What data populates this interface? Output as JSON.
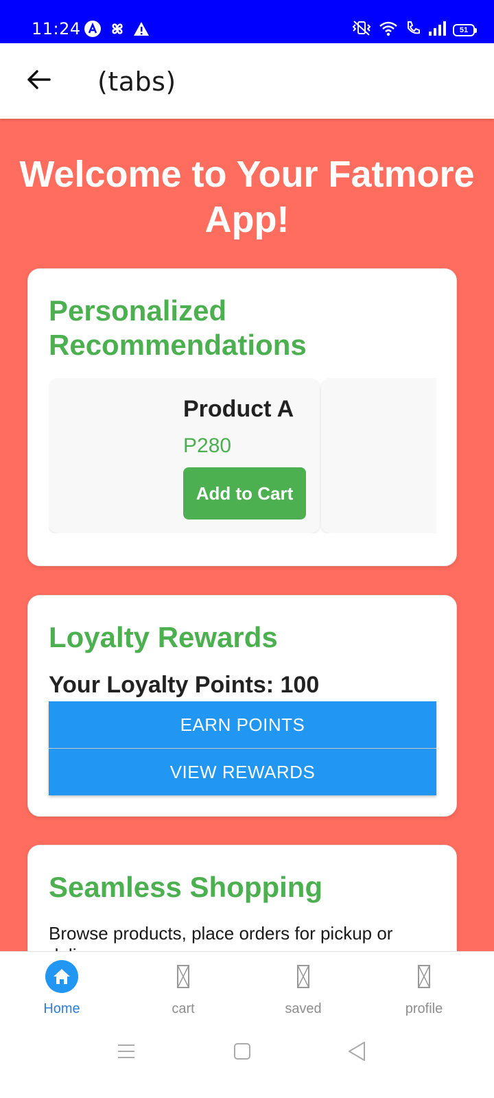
{
  "status_bar": {
    "time": "11:24",
    "battery": "51",
    "left_icons": [
      "a-circle-icon",
      "fan-icon",
      "warning-icon"
    ],
    "right_icons": [
      "vibrate-icon",
      "wifi-icon",
      "call-icon",
      "signal-icon",
      "battery-icon"
    ],
    "background": "#0000ff"
  },
  "header": {
    "back_icon": "arrow-left-icon",
    "title": "(tabs)"
  },
  "main": {
    "background": "#ff6d5e",
    "welcome_title": "Welcome to Your Fatmore App!",
    "recommendations": {
      "title": "Personalized Recommendations",
      "products": [
        {
          "name": "Product A",
          "price": "P280",
          "button_label": "Add to Cart"
        }
      ]
    },
    "loyalty": {
      "title": "Loyalty Rewards",
      "points_text": "Your Loyalty Points: 100",
      "earn_button": "EARN POINTS",
      "view_button": "VIEW REWARDS"
    },
    "shopping": {
      "title": "Seamless Shopping",
      "description": "Browse products, place orders for pickup or delivery"
    }
  },
  "tab_bar": {
    "tabs": [
      {
        "label": "Home",
        "icon": "home-icon",
        "active": true
      },
      {
        "label": "cart",
        "icon": "missing-image-icon",
        "active": false
      },
      {
        "label": "saved",
        "icon": "missing-image-icon",
        "active": false
      },
      {
        "label": "profile",
        "icon": "missing-image-icon",
        "active": false
      }
    ],
    "active_color": "#2f7ed8"
  },
  "nav_bar": {
    "buttons": [
      "menu-icon",
      "home-square-icon",
      "back-triangle-icon"
    ]
  },
  "colors": {
    "accent_green": "#4caf50",
    "accent_blue": "#2196f3"
  }
}
